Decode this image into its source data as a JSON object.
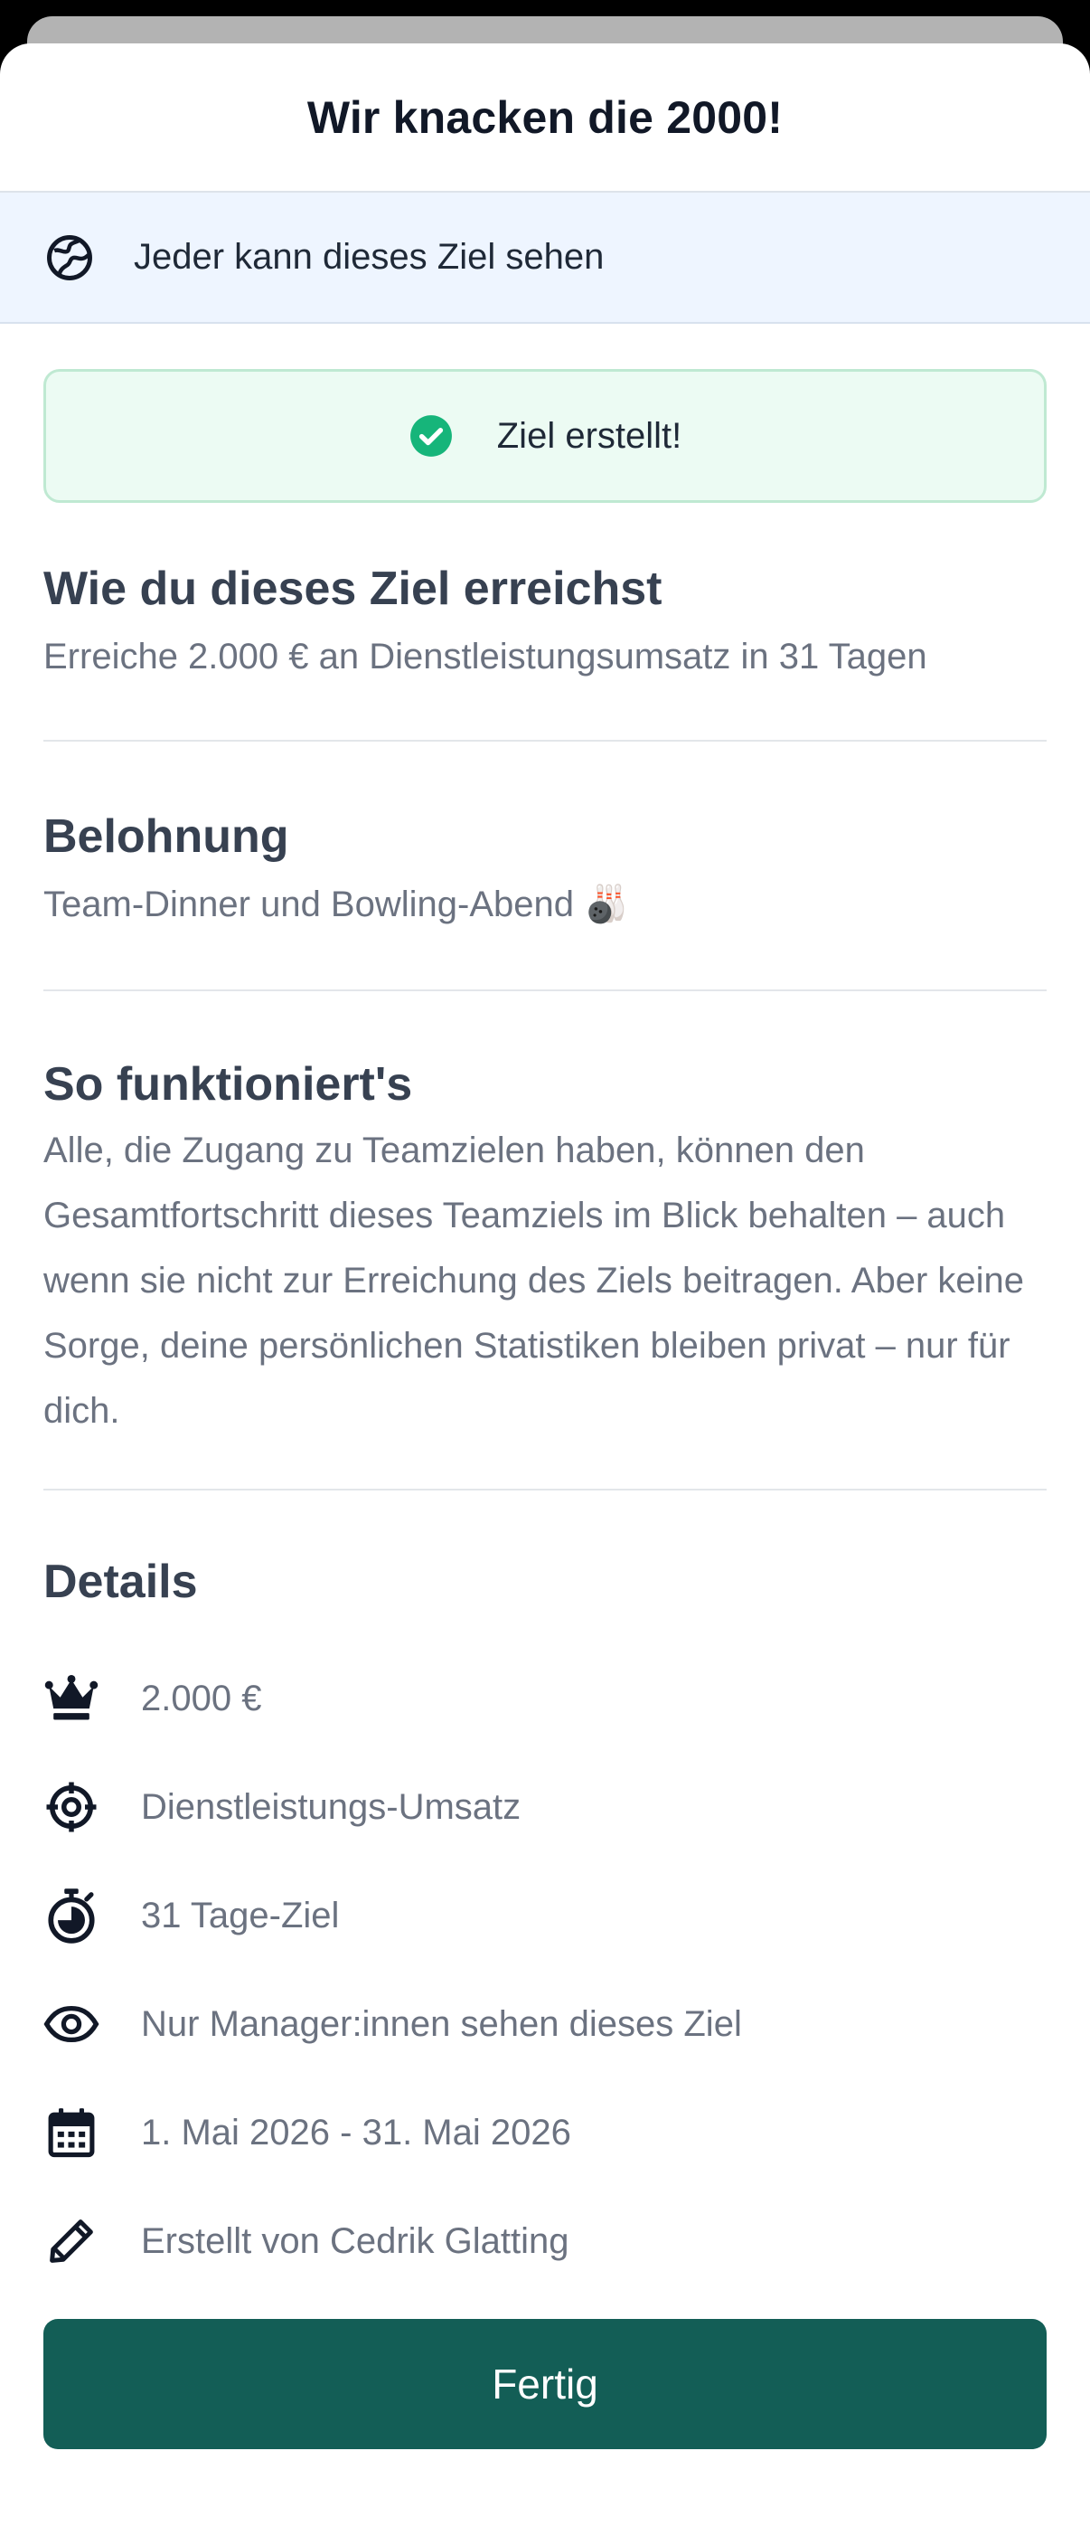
{
  "sheet": {
    "title": "Wir knacken die 2000!"
  },
  "visibility_banner": {
    "icon": "globe-icon",
    "text": "Jeder kann dieses Ziel sehen"
  },
  "success": {
    "icon": "check-circle-icon",
    "text": "Ziel erstellt!",
    "color": "#16b57a"
  },
  "how_to": {
    "title": "Wie du dieses Ziel erreichst",
    "body": "Erreiche 2.000 € an Dienstleistungsumsatz in 31 Tagen"
  },
  "reward": {
    "title": "Belohnung",
    "body": "Team-Dinner und Bowling-Abend 🎳"
  },
  "how_it_works": {
    "title": "So funktioniert's",
    "body": "Alle, die Zugang zu Teamzielen haben, können den Gesamtfortschritt dieses Teamziels im Blick behalten – auch wenn sie nicht zur Erreichung des Ziels beitragen. Aber keine Sorge, deine persönlichen Statistiken bleiben privat – nur für dich."
  },
  "details": {
    "title": "Details",
    "items": [
      {
        "icon": "crown-icon",
        "text": "2.000 €"
      },
      {
        "icon": "crosshair-icon",
        "text": "Dienstleistungs-Umsatz"
      },
      {
        "icon": "stopwatch-icon",
        "text": "31 Tage-Ziel"
      },
      {
        "icon": "eye-icon",
        "text": " Nur Manager:innen sehen dieses Ziel"
      },
      {
        "icon": "calendar-icon",
        "text": "1. Mai 2026 - 31. Mai 2026"
      },
      {
        "icon": "pencil-icon",
        "text": "Erstellt von Cedrik Glatting"
      }
    ]
  },
  "footer": {
    "done_label": "Fertig",
    "button_color": "#135e56"
  }
}
